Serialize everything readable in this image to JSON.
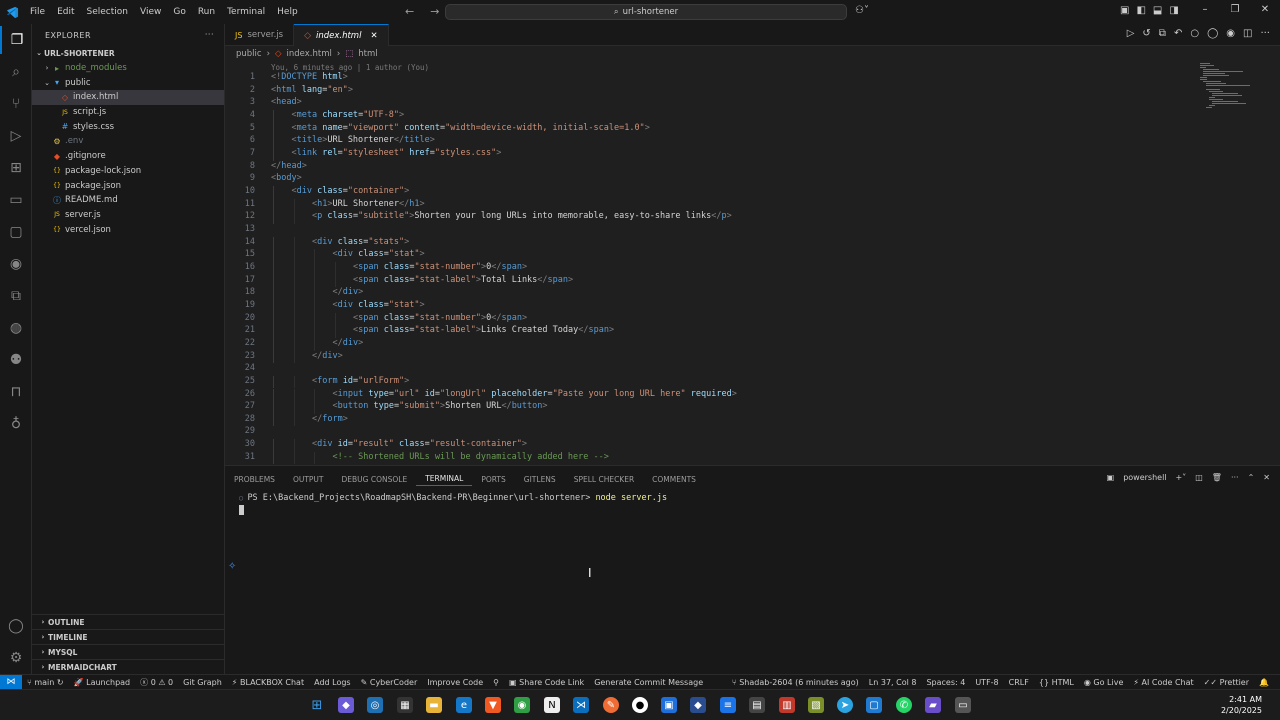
{
  "titlebar": {
    "menus": [
      "File",
      "Edit",
      "Selection",
      "View",
      "Go",
      "Run",
      "Terminal",
      "Help"
    ],
    "search_text": "url-shortener"
  },
  "sidebar": {
    "header": "EXPLORER",
    "root": "URL-SHORTENER",
    "tree": [
      {
        "label": "node_modules",
        "depth": 1,
        "kind": "folder",
        "expanded": false,
        "color": "#6b9955"
      },
      {
        "label": "public",
        "depth": 1,
        "kind": "folder",
        "expanded": true,
        "color": "#cccccc"
      },
      {
        "label": "index.html",
        "depth": 2,
        "kind": "html",
        "color": "#cccccc",
        "selected": true
      },
      {
        "label": "script.js",
        "depth": 2,
        "kind": "js",
        "color": "#cccccc"
      },
      {
        "label": "styles.css",
        "depth": 2,
        "kind": "css",
        "color": "#cccccc"
      },
      {
        "label": ".env",
        "depth": 1,
        "kind": "env",
        "color": "#6e7681"
      },
      {
        "label": ".gitignore",
        "depth": 1,
        "kind": "git",
        "color": "#cccccc"
      },
      {
        "label": "package-lock.json",
        "depth": 1,
        "kind": "json",
        "color": "#cccccc"
      },
      {
        "label": "package.json",
        "depth": 1,
        "kind": "json",
        "color": "#cccccc"
      },
      {
        "label": "README.md",
        "depth": 1,
        "kind": "md",
        "color": "#cccccc"
      },
      {
        "label": "server.js",
        "depth": 1,
        "kind": "js",
        "color": "#cccccc"
      },
      {
        "label": "vercel.json",
        "depth": 1,
        "kind": "json",
        "color": "#cccccc"
      }
    ],
    "sections": [
      "OUTLINE",
      "TIMELINE",
      "MYSQL",
      "MERMAIDCHART"
    ]
  },
  "tabs": [
    {
      "label": "server.js",
      "active": false
    },
    {
      "label": "index.html",
      "active": true
    }
  ],
  "breadcrumb": [
    "public",
    "index.html",
    "html"
  ],
  "editor": {
    "blame": "You, 6 minutes ago | 1 author (You)",
    "lines": [
      {
        "n": "1",
        "indent": 0,
        "segs": [
          [
            "pn",
            "<!"
          ],
          [
            "tg",
            "DOCTYPE"
          ],
          [
            "at",
            " html"
          ],
          [
            "pn",
            ">"
          ]
        ]
      },
      {
        "n": "2",
        "indent": 0,
        "segs": [
          [
            "pn",
            "<"
          ],
          [
            "tg",
            "html"
          ],
          [
            "at",
            " lang"
          ],
          [
            "tx",
            "="
          ],
          [
            "st",
            "\"en\""
          ],
          [
            "pn",
            ">"
          ]
        ]
      },
      {
        "n": "3",
        "indent": 0,
        "segs": [
          [
            "pn",
            "<"
          ],
          [
            "tg",
            "head"
          ],
          [
            "pn",
            ">"
          ]
        ]
      },
      {
        "n": "4",
        "indent": 1,
        "segs": [
          [
            "pn",
            "<"
          ],
          [
            "tg",
            "meta"
          ],
          [
            "at",
            " charset"
          ],
          [
            "tx",
            "="
          ],
          [
            "st",
            "\"UTF-8\""
          ],
          [
            "pn",
            ">"
          ]
        ]
      },
      {
        "n": "5",
        "indent": 1,
        "segs": [
          [
            "pn",
            "<"
          ],
          [
            "tg",
            "meta"
          ],
          [
            "at",
            " name"
          ],
          [
            "tx",
            "="
          ],
          [
            "st",
            "\"viewport\""
          ],
          [
            "at",
            " content"
          ],
          [
            "tx",
            "="
          ],
          [
            "st",
            "\"width=device-width, initial-scale=1.0\""
          ],
          [
            "pn",
            ">"
          ]
        ]
      },
      {
        "n": "6",
        "indent": 1,
        "segs": [
          [
            "pn",
            "<"
          ],
          [
            "tg",
            "title"
          ],
          [
            "pn",
            ">"
          ],
          [
            "tx",
            "URL Shortener"
          ],
          [
            "pn",
            "</"
          ],
          [
            "tg",
            "title"
          ],
          [
            "pn",
            ">"
          ]
        ]
      },
      {
        "n": "7",
        "indent": 1,
        "segs": [
          [
            "pn",
            "<"
          ],
          [
            "tg",
            "link"
          ],
          [
            "at",
            " rel"
          ],
          [
            "tx",
            "="
          ],
          [
            "st",
            "\"stylesheet\""
          ],
          [
            "at",
            " href"
          ],
          [
            "tx",
            "="
          ],
          [
            "st",
            "\"styles.css\""
          ],
          [
            "pn",
            ">"
          ]
        ]
      },
      {
        "n": "8",
        "indent": 0,
        "segs": [
          [
            "pn",
            "</"
          ],
          [
            "tg",
            "head"
          ],
          [
            "pn",
            ">"
          ]
        ]
      },
      {
        "n": "9",
        "indent": 0,
        "segs": [
          [
            "pn",
            "<"
          ],
          [
            "tg",
            "body"
          ],
          [
            "pn",
            ">"
          ]
        ]
      },
      {
        "n": "10",
        "indent": 1,
        "segs": [
          [
            "pn",
            "<"
          ],
          [
            "tg",
            "div"
          ],
          [
            "at",
            " class"
          ],
          [
            "tx",
            "="
          ],
          [
            "st",
            "\"container\""
          ],
          [
            "pn",
            ">"
          ]
        ]
      },
      {
        "n": "11",
        "indent": 2,
        "segs": [
          [
            "pn",
            "<"
          ],
          [
            "tg",
            "h1"
          ],
          [
            "pn",
            ">"
          ],
          [
            "tx",
            "URL Shortener"
          ],
          [
            "pn",
            "</"
          ],
          [
            "tg",
            "h1"
          ],
          [
            "pn",
            ">"
          ]
        ]
      },
      {
        "n": "12",
        "indent": 2,
        "segs": [
          [
            "pn",
            "<"
          ],
          [
            "tg",
            "p"
          ],
          [
            "at",
            " class"
          ],
          [
            "tx",
            "="
          ],
          [
            "st",
            "\"subtitle\""
          ],
          [
            "pn",
            ">"
          ],
          [
            "tx",
            "Shorten your long URLs into memorable, easy-to-share links"
          ],
          [
            "pn",
            "</"
          ],
          [
            "tg",
            "p"
          ],
          [
            "pn",
            ">"
          ]
        ]
      },
      {
        "n": "13",
        "indent": 0,
        "segs": []
      },
      {
        "n": "14",
        "indent": 2,
        "segs": [
          [
            "pn",
            "<"
          ],
          [
            "tg",
            "div"
          ],
          [
            "at",
            " class"
          ],
          [
            "tx",
            "="
          ],
          [
            "st",
            "\"stats\""
          ],
          [
            "pn",
            ">"
          ]
        ]
      },
      {
        "n": "15",
        "indent": 3,
        "segs": [
          [
            "pn",
            "<"
          ],
          [
            "tg",
            "div"
          ],
          [
            "at",
            " class"
          ],
          [
            "tx",
            "="
          ],
          [
            "st",
            "\"stat\""
          ],
          [
            "pn",
            ">"
          ]
        ]
      },
      {
        "n": "16",
        "indent": 4,
        "segs": [
          [
            "pn",
            "<"
          ],
          [
            "tg",
            "span"
          ],
          [
            "at",
            " class"
          ],
          [
            "tx",
            "="
          ],
          [
            "st",
            "\"stat-number\""
          ],
          [
            "pn",
            ">"
          ],
          [
            "tx",
            "0"
          ],
          [
            "pn",
            "</"
          ],
          [
            "tg",
            "span"
          ],
          [
            "pn",
            ">"
          ]
        ]
      },
      {
        "n": "17",
        "indent": 4,
        "segs": [
          [
            "pn",
            "<"
          ],
          [
            "tg",
            "span"
          ],
          [
            "at",
            " class"
          ],
          [
            "tx",
            "="
          ],
          [
            "st",
            "\"stat-label\""
          ],
          [
            "pn",
            ">"
          ],
          [
            "tx",
            "Total Links"
          ],
          [
            "pn",
            "</"
          ],
          [
            "tg",
            "span"
          ],
          [
            "pn",
            ">"
          ]
        ]
      },
      {
        "n": "18",
        "indent": 3,
        "segs": [
          [
            "pn",
            "</"
          ],
          [
            "tg",
            "div"
          ],
          [
            "pn",
            ">"
          ]
        ]
      },
      {
        "n": "19",
        "indent": 3,
        "segs": [
          [
            "pn",
            "<"
          ],
          [
            "tg",
            "div"
          ],
          [
            "at",
            " class"
          ],
          [
            "tx",
            "="
          ],
          [
            "st",
            "\"stat\""
          ],
          [
            "pn",
            ">"
          ]
        ]
      },
      {
        "n": "20",
        "indent": 4,
        "segs": [
          [
            "pn",
            "<"
          ],
          [
            "tg",
            "span"
          ],
          [
            "at",
            " class"
          ],
          [
            "tx",
            "="
          ],
          [
            "st",
            "\"stat-number\""
          ],
          [
            "pn",
            ">"
          ],
          [
            "tx",
            "0"
          ],
          [
            "pn",
            "</"
          ],
          [
            "tg",
            "span"
          ],
          [
            "pn",
            ">"
          ]
        ]
      },
      {
        "n": "21",
        "indent": 4,
        "segs": [
          [
            "pn",
            "<"
          ],
          [
            "tg",
            "span"
          ],
          [
            "at",
            " class"
          ],
          [
            "tx",
            "="
          ],
          [
            "st",
            "\"stat-label\""
          ],
          [
            "pn",
            ">"
          ],
          [
            "tx",
            "Links Created Today"
          ],
          [
            "pn",
            "</"
          ],
          [
            "tg",
            "span"
          ],
          [
            "pn",
            ">"
          ]
        ]
      },
      {
        "n": "22",
        "indent": 3,
        "segs": [
          [
            "pn",
            "</"
          ],
          [
            "tg",
            "div"
          ],
          [
            "pn",
            ">"
          ]
        ]
      },
      {
        "n": "23",
        "indent": 2,
        "segs": [
          [
            "pn",
            "</"
          ],
          [
            "tg",
            "div"
          ],
          [
            "pn",
            ">"
          ]
        ]
      },
      {
        "n": "24",
        "indent": 0,
        "segs": []
      },
      {
        "n": "25",
        "indent": 2,
        "segs": [
          [
            "pn",
            "<"
          ],
          [
            "tg",
            "form"
          ],
          [
            "at",
            " id"
          ],
          [
            "tx",
            "="
          ],
          [
            "st",
            "\"urlForm\""
          ],
          [
            "pn",
            ">"
          ]
        ]
      },
      {
        "n": "26",
        "indent": 3,
        "segs": [
          [
            "pn",
            "<"
          ],
          [
            "tg",
            "input"
          ],
          [
            "at",
            " type"
          ],
          [
            "tx",
            "="
          ],
          [
            "st",
            "\"url\""
          ],
          [
            "at",
            " id"
          ],
          [
            "tx",
            "="
          ],
          [
            "st",
            "\"longUrl\""
          ],
          [
            "at",
            " placeholder"
          ],
          [
            "tx",
            "="
          ],
          [
            "st",
            "\"Paste your long URL here\""
          ],
          [
            "at",
            " required"
          ],
          [
            "pn",
            ">"
          ]
        ]
      },
      {
        "n": "27",
        "indent": 3,
        "segs": [
          [
            "pn",
            "<"
          ],
          [
            "tg",
            "button"
          ],
          [
            "at",
            " type"
          ],
          [
            "tx",
            "="
          ],
          [
            "st",
            "\"submit\""
          ],
          [
            "pn",
            ">"
          ],
          [
            "tx",
            "Shorten URL"
          ],
          [
            "pn",
            "</"
          ],
          [
            "tg",
            "button"
          ],
          [
            "pn",
            ">"
          ]
        ]
      },
      {
        "n": "28",
        "indent": 2,
        "segs": [
          [
            "pn",
            "</"
          ],
          [
            "tg",
            "form"
          ],
          [
            "pn",
            ">"
          ]
        ]
      },
      {
        "n": "29",
        "indent": 0,
        "segs": []
      },
      {
        "n": "30",
        "indent": 2,
        "segs": [
          [
            "pn",
            "<"
          ],
          [
            "tg",
            "div"
          ],
          [
            "at",
            " id"
          ],
          [
            "tx",
            "="
          ],
          [
            "st",
            "\"result\""
          ],
          [
            "at",
            " class"
          ],
          [
            "tx",
            "="
          ],
          [
            "st",
            "\"result-container\""
          ],
          [
            "pn",
            ">"
          ]
        ]
      },
      {
        "n": "31",
        "indent": 3,
        "segs": [
          [
            "cm",
            "<!-- Shortened URLs will be dynamically added here -->"
          ]
        ]
      }
    ]
  },
  "panel": {
    "tabs": [
      "PROBLEMS",
      "OUTPUT",
      "DEBUG CONSOLE",
      "TERMINAL",
      "PORTS",
      "GITLENS",
      "SPELL CHECKER",
      "COMMENTS"
    ],
    "active_tab": "TERMINAL",
    "shell": "powershell",
    "prompt": "PS E:\\Backend_Projects\\RoadmapSH\\Backend-PR\\Beginner\\url-shortener>",
    "command": "node server.js"
  },
  "statusbar": {
    "branch": "main",
    "launchpad": "Launchpad",
    "errors": "0",
    "warnings": "0",
    "git_graph": "Git Graph",
    "blackbox": "BLACKBOX Chat",
    "add_logs": "Add Logs",
    "cybercoder": "CyberCoder",
    "improve_code": "Improve Code",
    "share_code": "Share Code Link",
    "commit_msg": "Generate Commit Message",
    "blame": "Shadab-2604 (6 minutes ago)",
    "position": "Ln 37, Col 8",
    "spaces": "Spaces: 4",
    "encoding": "UTF-8",
    "eol": "CRLF",
    "language": "HTML",
    "golive": "Go Live",
    "aichat": "AI Code Chat",
    "prettier": "Prettier"
  },
  "taskbar": {
    "time": "2:41 AM",
    "date": "2/20/2025"
  },
  "colors": {
    "accent": "#0078d4",
    "editor_bg": "#1f1f1f",
    "chrome_bg": "#181818"
  }
}
